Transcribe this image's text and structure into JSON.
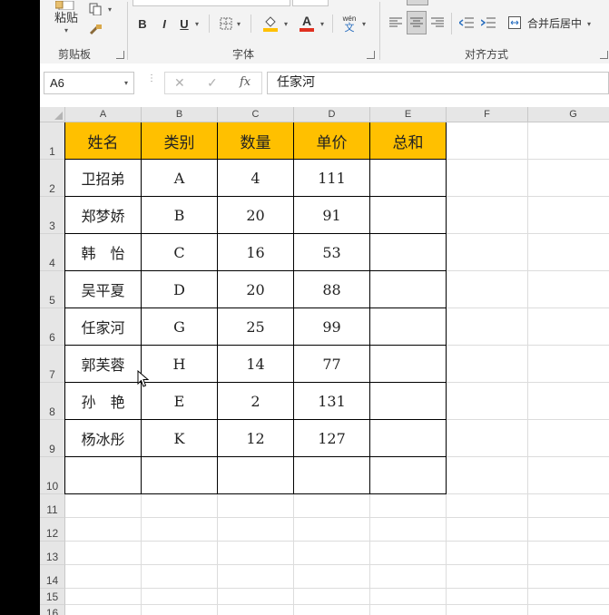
{
  "ribbon": {
    "paste_label": "粘贴",
    "clipboard_group": "剪贴板",
    "font_group": "字体",
    "align_group": "对齐方式",
    "bold": "B",
    "italic": "I",
    "underline": "U",
    "font_color_letter": "A",
    "phonetic_top": "wén",
    "phonetic_bottom": "文",
    "merge_center": "合并后居中"
  },
  "formula_bar": {
    "name_box": "A6",
    "fx": "fx",
    "cancel": "✕",
    "enter": "✓",
    "content": "任家河"
  },
  "columns": [
    "A",
    "B",
    "C",
    "D",
    "E",
    "F",
    "G"
  ],
  "rows": [
    "1",
    "2",
    "3",
    "4",
    "5",
    "6",
    "7",
    "8",
    "9",
    "10",
    "11",
    "12",
    "13",
    "14",
    "15",
    "16"
  ],
  "table": {
    "headers": [
      "姓名",
      "类别",
      "数量",
      "单价",
      "总和"
    ],
    "rows": [
      [
        "卫招弟",
        "A",
        "4",
        "111",
        ""
      ],
      [
        "郑梦娇",
        "B",
        "20",
        "91",
        ""
      ],
      [
        "韩　怡",
        "C",
        "16",
        "53",
        ""
      ],
      [
        "吴平夏",
        "D",
        "20",
        "88",
        ""
      ],
      [
        "任家河",
        "G",
        "25",
        "99",
        ""
      ],
      [
        "郭芙蓉",
        "H",
        "14",
        "77",
        ""
      ],
      [
        "孙　艳",
        "E",
        "2",
        "131",
        ""
      ],
      [
        "杨冰彤",
        "K",
        "12",
        "127",
        ""
      ],
      [
        "",
        "",
        "",
        "",
        ""
      ]
    ]
  },
  "colors": {
    "header_fill": "#ffc000",
    "ribbon_bg": "#f3f3f3"
  }
}
